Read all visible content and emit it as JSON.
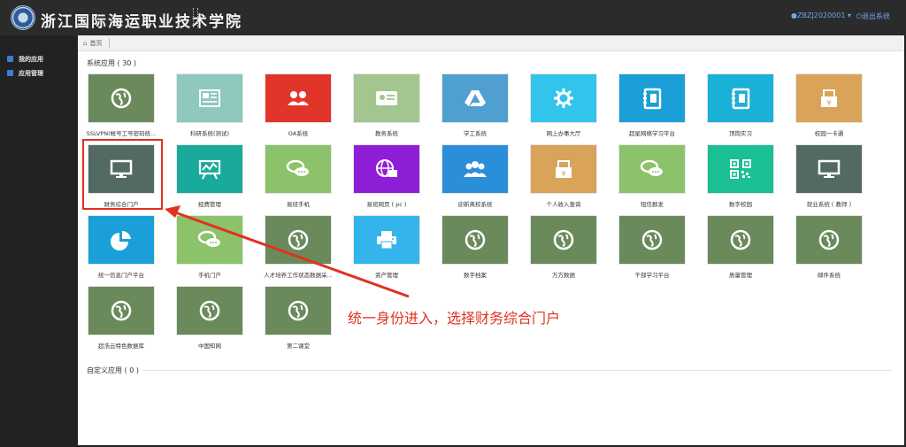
{
  "header": {
    "school_name": "浙江国际海运职业技术学院",
    "user": "ZBZJ2020001",
    "logout": "退出系统"
  },
  "sidebar": {
    "items": [
      {
        "label": "我的应用"
      },
      {
        "label": "应用管理"
      }
    ]
  },
  "breadcrumb": {
    "home": "首页"
  },
  "sections": {
    "system_apps": "系统应用 ( 30 )",
    "custom_apps": "自定义应用 ( 0 )"
  },
  "apps": [
    {
      "label": "SSLVPN(帐号工号密码统...",
      "color": "#6a8a5c",
      "icon": "globe-icon"
    },
    {
      "label": "科研系统(测试)",
      "color": "#8ec8bf",
      "icon": "newspaper-icon"
    },
    {
      "label": "OA系统",
      "color": "#e2352a",
      "icon": "users-icon"
    },
    {
      "label": "教务系统",
      "color": "#a3c58f",
      "icon": "id-card-icon"
    },
    {
      "label": "学工系统",
      "color": "#4f9fd1",
      "icon": "drive-icon"
    },
    {
      "label": "网上办事大厅",
      "color": "#33c4ec",
      "icon": "gear-icon"
    },
    {
      "label": "超星网络学习平台",
      "color": "#1a9fd8",
      "icon": "address-book-icon"
    },
    {
      "label": "顶岗实习",
      "color": "#1ab0d8",
      "icon": "address-book-icon"
    },
    {
      "label": "校园一卡通",
      "color": "#d9a35a",
      "icon": "wallet-icon"
    },
    {
      "label": "财务综合门户",
      "color": "#536a64",
      "icon": "monitor-icon"
    },
    {
      "label": "经费管理",
      "color": "#1aaa9c",
      "icon": "presentation-icon"
    },
    {
      "label": "易班手机",
      "color": "#8cc26a",
      "icon": "chat-icon"
    },
    {
      "label": "易班网页 ( pc )",
      "color": "#8f1fd6",
      "icon": "web-globe-icon"
    },
    {
      "label": "迎新离校系统",
      "color": "#2b8ed8",
      "icon": "team-icon"
    },
    {
      "label": "个人收入查询",
      "color": "#d9a35a",
      "icon": "wallet-icon"
    },
    {
      "label": "短信群发",
      "color": "#8cc26a",
      "icon": "chat-icon"
    },
    {
      "label": "数字校园",
      "color": "#1bbf94",
      "icon": "qr-code-icon"
    },
    {
      "label": "就业系统 ( 教师 )",
      "color": "#536a64",
      "icon": "monitor-icon"
    },
    {
      "label": "统一信息门户平台",
      "color": "#1a9fd8",
      "icon": "pie-chart-icon"
    },
    {
      "label": "手机门户",
      "color": "#8cc26a",
      "icon": "chat-icon"
    },
    {
      "label": "人才培养工作状态数据采...",
      "color": "#6a8a5c",
      "icon": "globe-icon"
    },
    {
      "label": "资产管理",
      "color": "#33b5ec",
      "icon": "printer-icon"
    },
    {
      "label": "数字档案",
      "color": "#6a8a5c",
      "icon": "globe-icon"
    },
    {
      "label": "万方数据",
      "color": "#6a8a5c",
      "icon": "globe-icon"
    },
    {
      "label": "干部学习平台",
      "color": "#6a8a5c",
      "icon": "globe-icon"
    },
    {
      "label": "质量管理",
      "color": "#6a8a5c",
      "icon": "globe-icon"
    },
    {
      "label": "邮件系统",
      "color": "#6a8a5c",
      "icon": "globe-icon"
    },
    {
      "label": "超浩云特色数据库",
      "color": "#6a8a5c",
      "icon": "globe-icon"
    },
    {
      "label": "中国知网",
      "color": "#6a8a5c",
      "icon": "globe-icon"
    },
    {
      "label": "第二课堂",
      "color": "#6a8a5c",
      "icon": "globe-icon"
    }
  ],
  "annotation": {
    "text": "统一身份进入，选择财务综合门户",
    "color": "#e0321e"
  }
}
